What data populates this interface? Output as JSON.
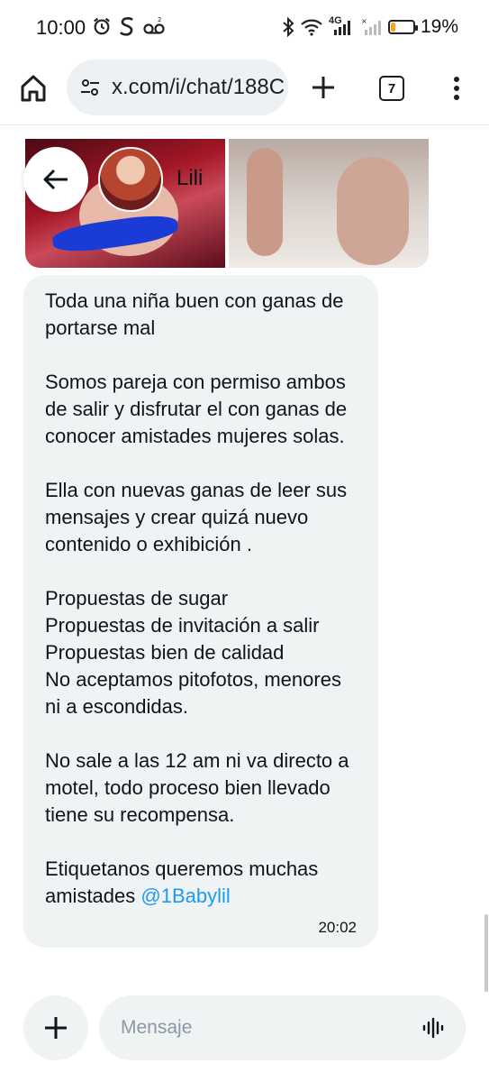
{
  "status_bar": {
    "time": "10:00",
    "left_icons": [
      "alarm-icon",
      "s-app-icon",
      "voicemail-icon"
    ],
    "right_icons": [
      "bluetooth-icon",
      "wifi-icon",
      "signal-4g-icon",
      "signal-icon"
    ],
    "network": "4G",
    "battery_percent": "19%",
    "battery_level": 0.19,
    "battery_color": "#f5a623"
  },
  "browser": {
    "url": "x.com/i/chat/188C",
    "tab_count": "7",
    "icons": [
      "home-icon",
      "tune-icon",
      "plus-icon",
      "menu-dots-icon"
    ]
  },
  "chat_header": {
    "contact_name": "Lili",
    "back_icon": "arrow-left-icon"
  },
  "message": {
    "text": "Toda una niña buen con ganas de portarse mal\n\nSomos pareja con permiso ambos de salir y disfrutar el con ganas de conocer amistades mujeres solas.\n\nElla con nuevas ganas de leer sus mensajes y crear quizá nuevo contenido o exhibición .\n\nPropuestas de sugar\nPropuestas de invitación a salir\nPropuestas bien de calidad\nNo aceptamos pitofotos, menores ni a escondidas.\n\nNo sale a las 12 am ni va directo a motel, todo proceso bien llevado tiene su recompensa.\n\nEtiquetanos queremos muchas amistades ",
    "mention": "@1Babylil",
    "time": "20:02",
    "mention_color": "#1d9bf0",
    "bubble_color": "#eff3f4"
  },
  "composer": {
    "placeholder": "Mensaje",
    "icons": [
      "plus-icon",
      "voice-wave-icon"
    ]
  }
}
